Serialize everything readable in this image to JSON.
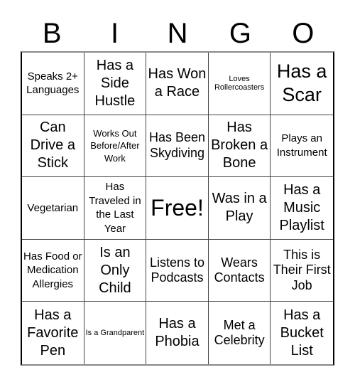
{
  "card": {
    "header": [
      "B",
      "I",
      "N",
      "G",
      "O"
    ],
    "cells": [
      {
        "text": "Speaks 2+ Languages",
        "size": "s-md"
      },
      {
        "text": "Has a Side Hustle",
        "size": "s-xl"
      },
      {
        "text": "Has Won a Race",
        "size": "s-xl"
      },
      {
        "text": "Loves Rollercoasters",
        "size": "s-xs"
      },
      {
        "text": "Has a Scar",
        "size": "s-xxl"
      },
      {
        "text": "Can Drive a Stick",
        "size": "s-xl"
      },
      {
        "text": "Works Out Before/After Work",
        "size": "s-sm"
      },
      {
        "text": "Has Been Skydiving",
        "size": "s-lg"
      },
      {
        "text": "Has Broken a Bone",
        "size": "s-xl"
      },
      {
        "text": "Plays an Instrument",
        "size": "s-md"
      },
      {
        "text": "Vegetarian",
        "size": "s-md"
      },
      {
        "text": "Has Traveled in the Last Year",
        "size": "s-md"
      },
      {
        "text": "Free!",
        "size": "s-free"
      },
      {
        "text": "Was in a Play",
        "size": "s-xl"
      },
      {
        "text": "Has a Music Playlist",
        "size": "s-xl"
      },
      {
        "text": "Has Food or Medication Allergies",
        "size": "s-md"
      },
      {
        "text": "Is an Only Child",
        "size": "s-xl"
      },
      {
        "text": "Listens to Podcasts",
        "size": "s-lg"
      },
      {
        "text": "Wears Contacts",
        "size": "s-lg"
      },
      {
        "text": "This is Their First Job",
        "size": "s-lg"
      },
      {
        "text": "Has a Favorite Pen",
        "size": "s-xl"
      },
      {
        "text": "Is a Grandparent",
        "size": "s-xs"
      },
      {
        "text": "Has a Phobia",
        "size": "s-xl"
      },
      {
        "text": "Met a Celebrity",
        "size": "s-lg"
      },
      {
        "text": "Has a Bucket List",
        "size": "s-xl"
      }
    ]
  }
}
